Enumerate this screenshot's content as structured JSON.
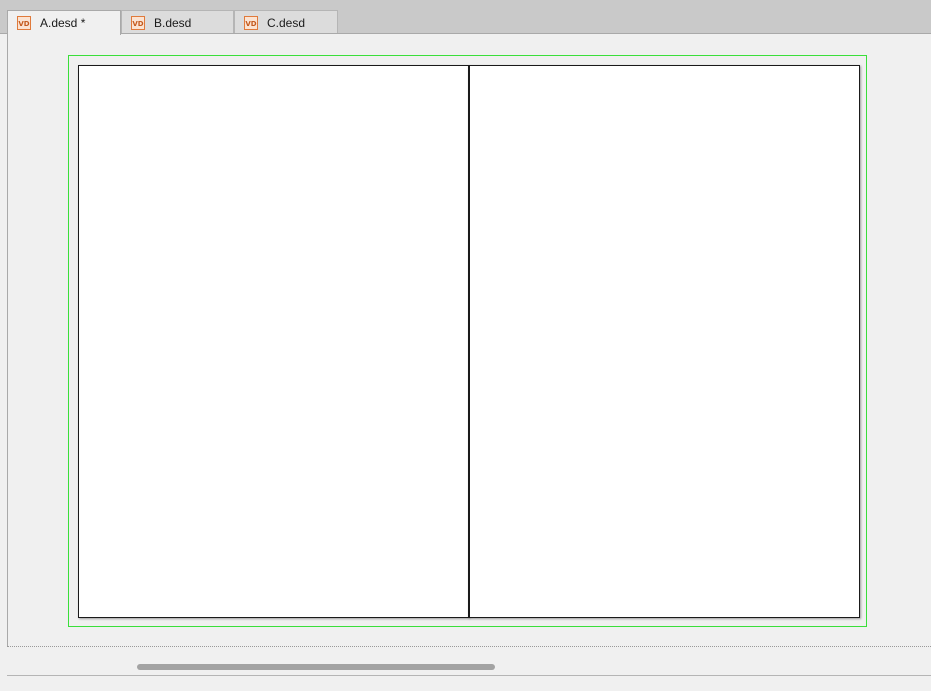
{
  "tabs": [
    {
      "label": "A.desd *",
      "active": true,
      "icon": "vd-file-icon"
    },
    {
      "label": "B.desd",
      "active": false,
      "icon": "vd-file-icon"
    },
    {
      "label": "C.desd",
      "active": false,
      "icon": "vd-file-icon"
    }
  ],
  "colors": {
    "selection": "#3adf3a",
    "file_icon": "#e07a3b"
  },
  "icon_text": "VD"
}
